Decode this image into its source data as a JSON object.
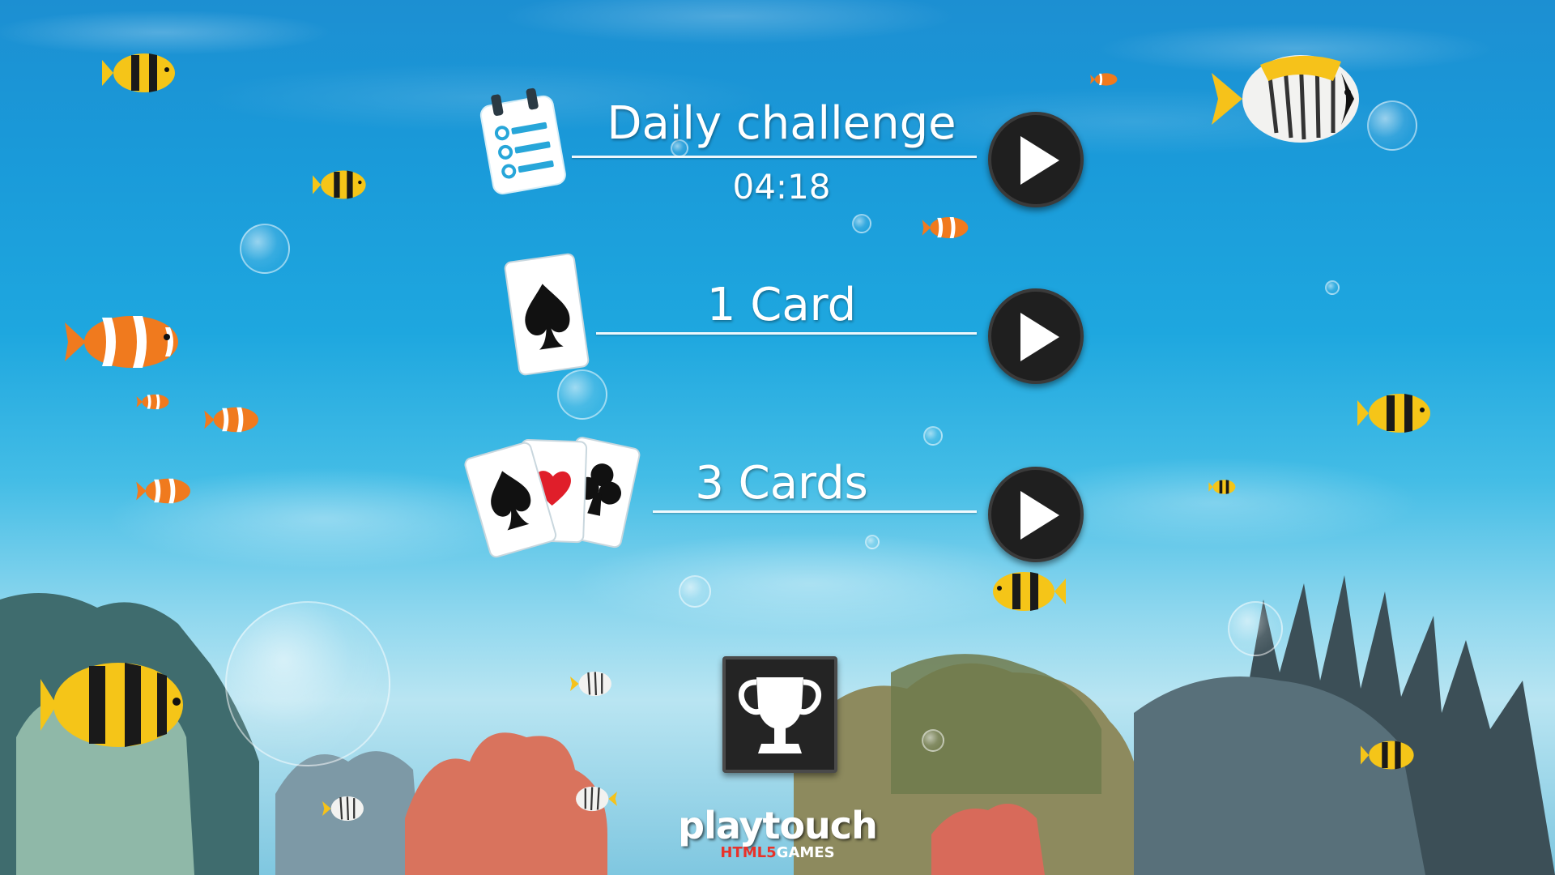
{
  "menu": {
    "daily": {
      "title": "Daily challenge",
      "timer": "04:18"
    },
    "one_card": {
      "title": "1 Card"
    },
    "three_cards": {
      "title": "3 Cards"
    }
  },
  "logo": {
    "main": "playtouch",
    "sub_html5": "HTML5",
    "sub_games": "GAMES"
  },
  "icons": {
    "daily": "checklist-calendar-icon",
    "one_card": "spade-card-icon",
    "three_cards": "spade-heart-club-cards-icon",
    "play": "play-icon",
    "trophy": "trophy-icon"
  },
  "colors": {
    "button_bg": "#1f1f1f",
    "text": "#ffffff",
    "accent_red": "#e8322a",
    "checklist_blue": "#27a6d9"
  }
}
